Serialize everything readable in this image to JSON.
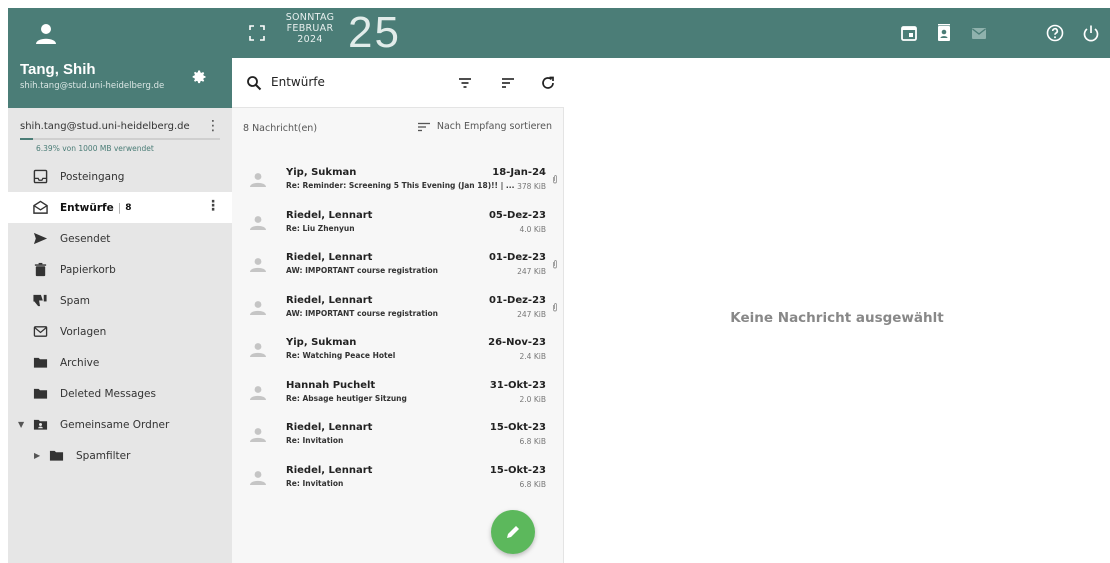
{
  "header": {
    "weekday": "SONNTAG",
    "month": "FEBRUAR",
    "year": "2024",
    "day": "25",
    "icons": [
      "fullscreen-icon",
      "calendar-icon",
      "contacts-icon",
      "mail-icon",
      "help-icon",
      "power-icon"
    ]
  },
  "user": {
    "name": "Tang, Shih",
    "email": "shih.tang@stud.uni-heidelberg.de"
  },
  "account": {
    "address": "shih.tang@stud.uni-heidelberg.de",
    "usage_text": "6.39% von 1000 MB verwendet",
    "usage_fraction": 0.0639
  },
  "folders": [
    {
      "label": "Posteingang",
      "icon": "inbox-icon"
    },
    {
      "label": "Entwürfe",
      "icon": "drafts-icon",
      "count": "8",
      "active": true
    },
    {
      "label": "Gesendet",
      "icon": "send-icon"
    },
    {
      "label": "Papierkorb",
      "icon": "trash-icon"
    },
    {
      "label": "Spam",
      "icon": "thumbs-down-icon"
    },
    {
      "label": "Vorlagen",
      "icon": "template-icon"
    },
    {
      "label": "Archive",
      "icon": "folder-icon"
    },
    {
      "label": "Deleted Messages",
      "icon": "folder-icon"
    },
    {
      "label": "Gemeinsame Ordner",
      "icon": "shared-folder-icon"
    },
    {
      "label": "Spamfilter",
      "icon": "folder-icon"
    }
  ],
  "list": {
    "search_text": "Entwürfe",
    "count_text": "8 Nachricht(en)",
    "sort_text": "Nach Empfang sortieren",
    "messages": [
      {
        "sender": "Yip, Sukman",
        "subject": "Re: Reminder: Screening 5 This Evening (Jan 18)!! | ...",
        "date": "18-Jan-24",
        "size": "378 KiB",
        "attachment": true
      },
      {
        "sender": "Riedel, Lennart",
        "subject": "Re: Liu Zhenyun",
        "date": "05-Dez-23",
        "size": "4.0 KiB",
        "attachment": false
      },
      {
        "sender": "Riedel, Lennart",
        "subject": "AW: IMPORTANT course registration",
        "date": "01-Dez-23",
        "size": "247 KiB",
        "attachment": true
      },
      {
        "sender": "Riedel, Lennart",
        "subject": "AW: IMPORTANT course registration",
        "date": "01-Dez-23",
        "size": "247 KiB",
        "attachment": true
      },
      {
        "sender": "Yip, Sukman",
        "subject": "Re: Watching Peace Hotel",
        "date": "26-Nov-23",
        "size": "2.4 KiB",
        "attachment": false
      },
      {
        "sender": "Hannah Puchelt",
        "subject": "Re: Absage heutiger Sitzung",
        "date": "31-Okt-23",
        "size": "2.0 KiB",
        "attachment": false
      },
      {
        "sender": "Riedel, Lennart",
        "subject": "Re: Invitation",
        "date": "15-Okt-23",
        "size": "6.8 KiB",
        "attachment": false
      },
      {
        "sender": "Riedel, Lennart",
        "subject": "Re: Invitation",
        "date": "15-Okt-23",
        "size": "6.8 KiB",
        "attachment": false
      }
    ]
  },
  "pane": {
    "empty_text": "Keine Nachricht ausgewählt"
  },
  "colors": {
    "accent": "#4b7d77",
    "fab": "#5cb85c",
    "sidebar_bg": "#e6e6e6"
  }
}
